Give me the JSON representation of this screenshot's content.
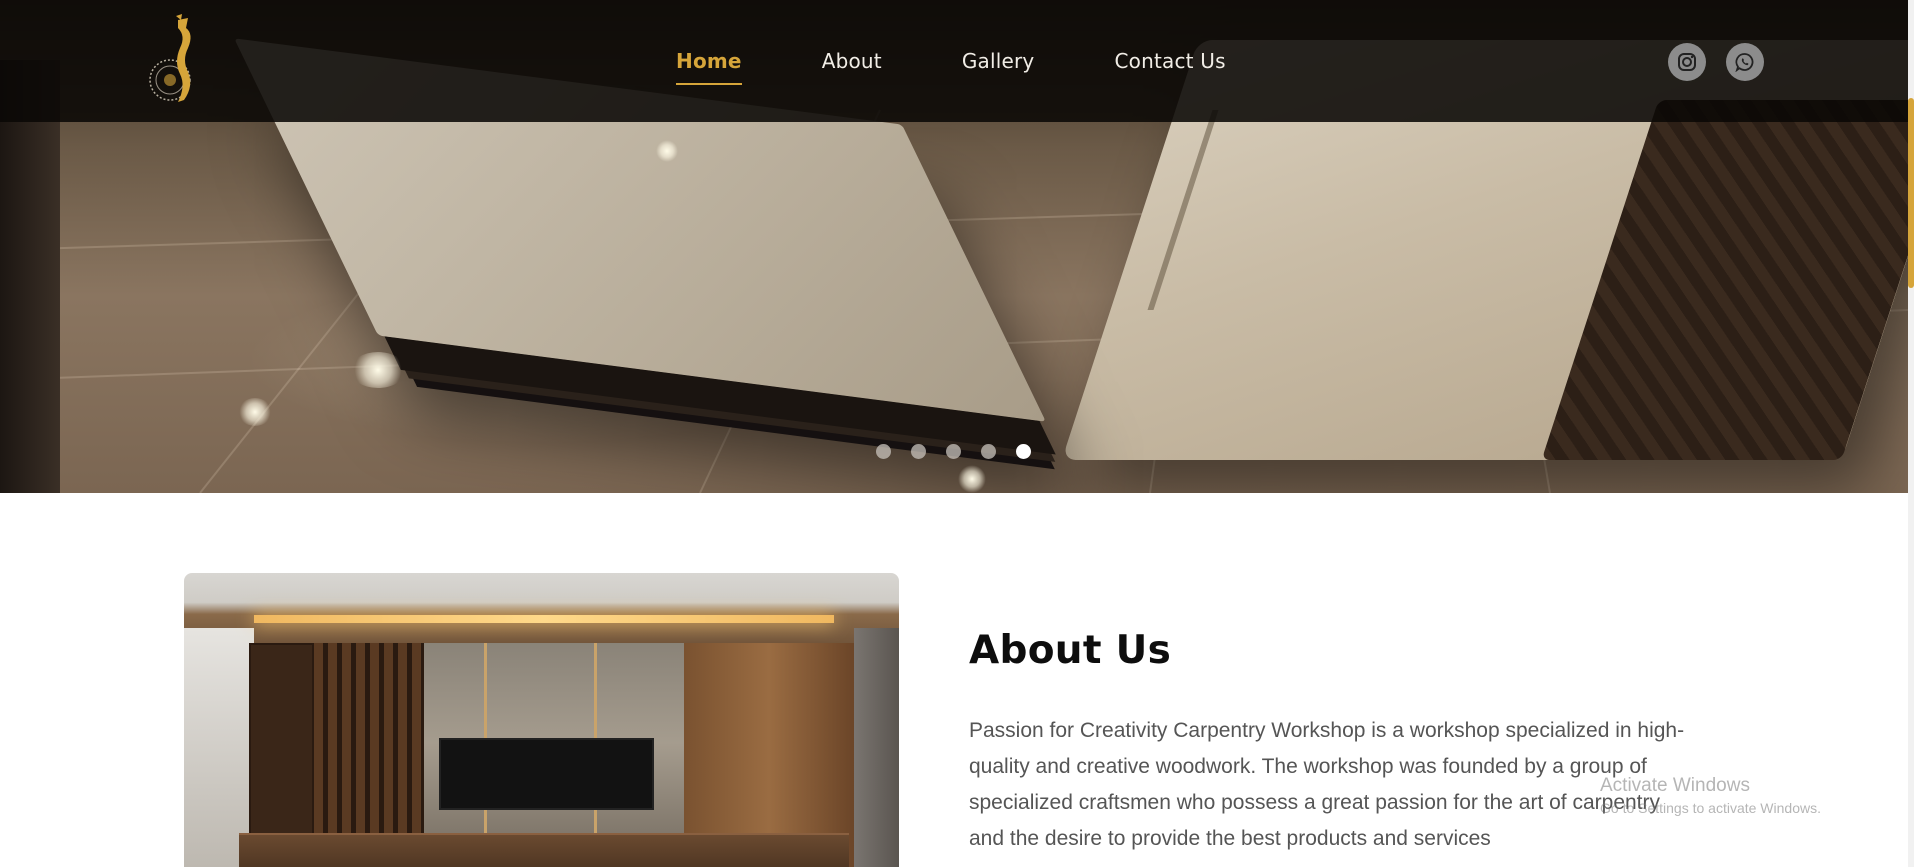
{
  "brand": {
    "logo_icon": "gold-calligraphy-logo-icon",
    "accent_color": "#d6a53a"
  },
  "nav": {
    "items": [
      {
        "label": "Home",
        "active": true
      },
      {
        "label": "About",
        "active": false
      },
      {
        "label": "Gallery",
        "active": false
      },
      {
        "label": "Contact Us",
        "active": false
      }
    ]
  },
  "social": [
    {
      "icon": "instagram-icon"
    },
    {
      "icon": "whatsapp-icon"
    }
  ],
  "carousel": {
    "slide_count": 5,
    "active_slide": 5,
    "image": "living-room-coffee-table-and-sofa"
  },
  "about": {
    "image": "tv-wall-wood-panel-interior",
    "title": "About Us",
    "paragraph": "Passion for Creativity Carpentry Workshop is a workshop specialized in high-quality and creative woodwork. The workshop was founded by a group of specialized craftsmen who possess a great passion for the art of carpentry and the desire to provide the best products and services"
  },
  "watermark": {
    "title": "Activate Windows",
    "subtitle": "Go to Settings to activate Windows."
  }
}
